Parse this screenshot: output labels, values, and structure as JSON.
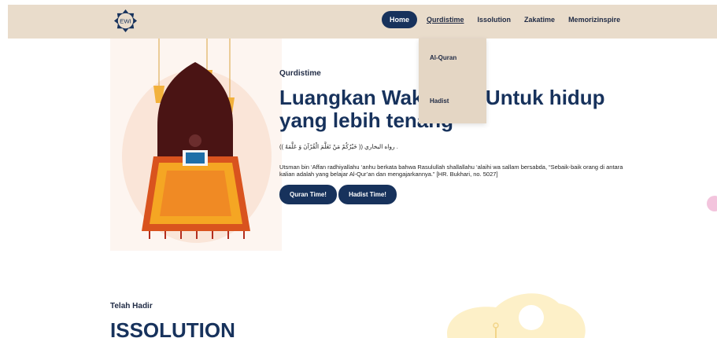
{
  "navbar": {
    "logo_text": "EWI",
    "items": [
      {
        "label": "Home"
      },
      {
        "label": "Qurdistime"
      },
      {
        "label": "Issolution"
      },
      {
        "label": "Zakatime"
      },
      {
        "label": "Memorizinspire"
      }
    ]
  },
  "dropdown": {
    "items": [
      {
        "label": "Al-Quran"
      },
      {
        "label": "Hadist"
      }
    ]
  },
  "hero": {
    "eyebrow": "Qurdistime",
    "headline": "Luangkan Waktumu! Untuk hidup yang lebih tenang",
    "arabic": "(( خَيْرُكُمْ مَنْ تَعَلَّمَ الْقُرْآنَ وَ عَلَّمَهُ )) رواه البخاري .",
    "hadith": "Utsman bin ‘Affan radhiyallahu ‘anhu berkata bahwa Rasulullah shallallahu ‘alaihi wa sallam bersabda, “Sebaik-baik orang di antara kalian adalah yang belajar Al-Qur’an dan mengajarkannya.” [HR. Bukhari, no. 5027]",
    "btn_quran": "Quran Time!",
    "btn_hadist": "Hadist Time!"
  },
  "section2": {
    "kicker": "Telah Hadir",
    "title": "ISSOLUTION"
  },
  "colors": {
    "navbar_bg": "#e9dccb",
    "primary": "#17325c",
    "dropdown_bg": "#e4d6c4",
    "accent_orange": "#f39c12"
  }
}
